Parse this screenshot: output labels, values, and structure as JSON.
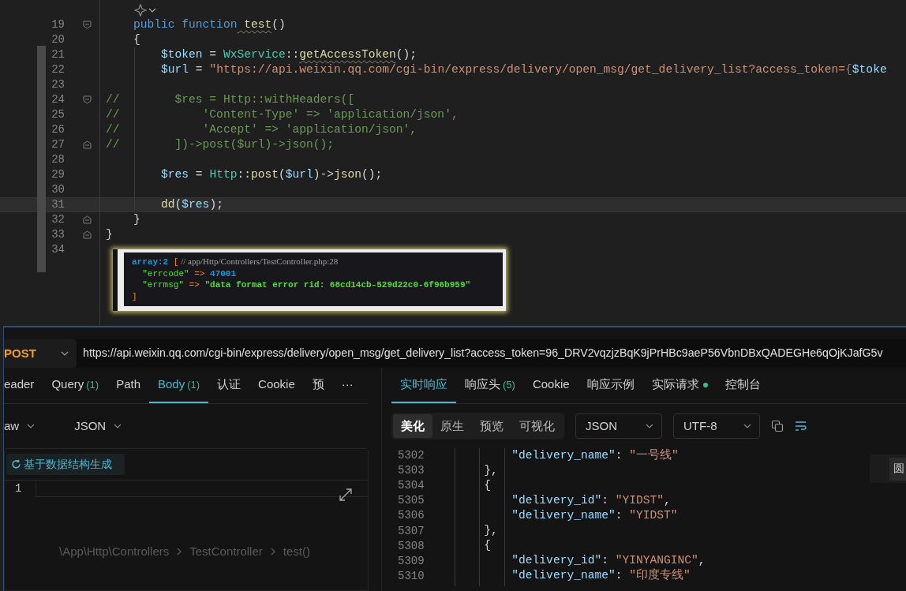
{
  "editor": {
    "lines": [
      {
        "number": "19",
        "kind": "fold-start",
        "current": false,
        "tokens": [
          {
            "text": "    public",
            "kind": "keyword"
          },
          {
            "text": " function",
            "kind": "keyword"
          },
          {
            "text": " test",
            "kind": "function",
            "warning": true
          },
          {
            "text": "()",
            "kind": "plain"
          }
        ]
      },
      {
        "number": "20",
        "kind": "plain",
        "current": false,
        "tokens": [
          {
            "text": "    {",
            "kind": "plain"
          }
        ]
      },
      {
        "number": "21",
        "kind": "plain",
        "current": false,
        "tokens": [
          {
            "text": "        $token",
            "kind": "variable"
          },
          {
            "text": " = ",
            "kind": "plain"
          },
          {
            "text": "WxService",
            "kind": "class"
          },
          {
            "text": "::",
            "kind": "plain"
          },
          {
            "text": "getAccessToken",
            "kind": "function",
            "warning": true
          },
          {
            "text": "();",
            "kind": "plain"
          }
        ]
      },
      {
        "number": "22",
        "kind": "plain",
        "current": false,
        "tokens": [
          {
            "text": "        $url",
            "kind": "variable"
          },
          {
            "text": " = ",
            "kind": "plain"
          },
          {
            "text": "\"https://api.weixin.qq.com/cgi-bin/express/delivery/open_msg/get_delivery_list?access_token=",
            "kind": "string"
          },
          {
            "text": "{",
            "kind": "brace"
          },
          {
            "text": "$toke",
            "kind": "variable"
          }
        ]
      },
      {
        "number": "23",
        "kind": "plain",
        "current": false
      },
      {
        "number": "24",
        "kind": "fold-start",
        "current": false,
        "tokens": [
          {
            "text": "//        $res = Http::withHeaders([",
            "kind": "comment"
          }
        ]
      },
      {
        "number": "25",
        "kind": "plain",
        "current": false,
        "tokens": [
          {
            "text": "//            'Content-Type' => 'application/json',",
            "kind": "comment"
          }
        ]
      },
      {
        "number": "26",
        "kind": "plain",
        "current": false,
        "tokens": [
          {
            "text": "//            'Accept' => 'application/json',",
            "kind": "comment"
          }
        ]
      },
      {
        "number": "27",
        "kind": "fold-end",
        "current": false,
        "tokens": [
          {
            "text": "//        ])->post($url)->json();",
            "kind": "comment"
          }
        ]
      },
      {
        "number": "28",
        "kind": "plain",
        "current": false
      },
      {
        "number": "29",
        "kind": "plain",
        "current": false,
        "tokens": [
          {
            "text": "        $res",
            "kind": "variable"
          },
          {
            "text": " = ",
            "kind": "plain"
          },
          {
            "text": "Http",
            "kind": "class"
          },
          {
            "text": "::",
            "kind": "plain"
          },
          {
            "text": "post",
            "kind": "function"
          },
          {
            "text": "(",
            "kind": "plain"
          },
          {
            "text": "$url",
            "kind": "variable"
          },
          {
            "text": ")->",
            "kind": "plain"
          },
          {
            "text": "json",
            "kind": "function"
          },
          {
            "text": "();",
            "kind": "plain"
          }
        ]
      },
      {
        "number": "30",
        "kind": "plain",
        "current": false
      },
      {
        "number": "31",
        "kind": "plain",
        "current": true,
        "tokens": [
          {
            "text": "        dd",
            "kind": "function"
          },
          {
            "text": "(",
            "kind": "plain"
          },
          {
            "text": "$res",
            "kind": "variable"
          },
          {
            "text": ");",
            "kind": "plain"
          }
        ]
      },
      {
        "number": "32",
        "kind": "fold-end",
        "current": false,
        "tokens": [
          {
            "text": "    }",
            "kind": "plain"
          }
        ]
      },
      {
        "number": "33",
        "kind": "fold-end",
        "current": false,
        "tokens": [
          {
            "text": "}",
            "kind": "plain"
          }
        ]
      },
      {
        "number": "34",
        "kind": "plain",
        "current": false
      }
    ]
  },
  "dump": {
    "lines": [
      [
        {
          "text": "array:2",
          "kind": "type"
        },
        {
          "text": " [",
          "kind": "punct"
        },
        {
          "text": " // app/Http/Controllers/TestController.php:28",
          "kind": "note"
        }
      ],
      [
        {
          "text": "  \"errcode\"",
          "kind": "key"
        },
        {
          "text": " =>",
          "kind": "punct"
        },
        {
          "text": " 47001",
          "kind": "number"
        }
      ],
      [
        {
          "text": "  \"errmsg\"",
          "kind": "key"
        },
        {
          "text": " =>",
          "kind": "punct"
        },
        {
          "text": " \"data format error rid: 68cd14cb-529d22c0-6f96b959\"",
          "kind": "string"
        }
      ],
      [
        {
          "text": "]",
          "kind": "punct"
        }
      ]
    ]
  },
  "apifox": {
    "method": "POST",
    "url": "https://api.weixin.qq.com/cgi-bin/express/delivery/open_msg/get_delivery_list?access_token=96_DRV2vqzjzBqK9jPrHBc9aeP56VbnDBxQADEGHe6qOjKJafG5v",
    "request_tabs": [
      {
        "label": "eader",
        "selected": false
      },
      {
        "label": "Query",
        "count": "(1)",
        "selected": false
      },
      {
        "label": "Path",
        "selected": false
      },
      {
        "label": "Body",
        "count": "(1)",
        "selected": true
      },
      {
        "label": "认证",
        "selected": false
      },
      {
        "label": "Cookie",
        "selected": false
      },
      {
        "label": "预",
        "selected": false
      }
    ],
    "more": "···",
    "body_mode": "aw",
    "body_format": "JSON",
    "generate_button": "基于数据结构生成",
    "body_lines": [
      "1"
    ],
    "breadcrumb": [
      "\\App\\Http\\Controllers",
      "TestController",
      "test()"
    ],
    "response_tabs": [
      {
        "label": "实时响应",
        "selected": true
      },
      {
        "label": "响应头",
        "count": "(5)",
        "selected": false
      },
      {
        "label": "Cookie",
        "selected": false
      },
      {
        "label": "响应示例",
        "selected": false
      },
      {
        "label": "实际请求",
        "selected": false,
        "color": "#2bc48a"
      },
      {
        "label": "控制台",
        "selected": false
      }
    ],
    "view_modes": [
      {
        "label": "美化",
        "selected": true
      },
      {
        "label": "原生",
        "selected": false
      },
      {
        "label": "预览",
        "selected": false
      },
      {
        "label": "可视化",
        "selected": false
      }
    ],
    "format": "JSON",
    "encoding": "UTF-8",
    "response_lines": [
      {
        "number": "5302",
        "tokens": [
          {
            "text": "           \"delivery_name\"",
            "kind": "key"
          },
          {
            "text": ": ",
            "kind": "punct"
          },
          {
            "text": "\"一号线\"",
            "kind": "string"
          }
        ]
      },
      {
        "number": "5303",
        "tokens": [
          {
            "text": "       },",
            "kind": "punct"
          }
        ]
      },
      {
        "number": "5304",
        "tokens": [
          {
            "text": "       {",
            "kind": "punct"
          }
        ]
      },
      {
        "number": "5305",
        "tokens": [
          {
            "text": "           \"delivery_id\"",
            "kind": "key"
          },
          {
            "text": ": ",
            "kind": "punct"
          },
          {
            "text": "\"YIDST\"",
            "kind": "string"
          },
          {
            "text": ",",
            "kind": "punct"
          }
        ]
      },
      {
        "number": "5306",
        "tokens": [
          {
            "text": "           \"delivery_name\"",
            "kind": "key"
          },
          {
            "text": ": ",
            "kind": "punct"
          },
          {
            "text": "\"YIDST\"",
            "kind": "string"
          }
        ]
      },
      {
        "number": "5307",
        "tokens": [
          {
            "text": "       },",
            "kind": "punct"
          }
        ]
      },
      {
        "number": "5308",
        "tokens": [
          {
            "text": "       {",
            "kind": "punct"
          }
        ]
      },
      {
        "number": "5309",
        "tokens": [
          {
            "text": "           \"delivery_id\"",
            "kind": "key"
          },
          {
            "text": ": ",
            "kind": "punct"
          },
          {
            "text": "\"YINYANGINC\"",
            "kind": "string"
          },
          {
            "text": ",",
            "kind": "punct"
          }
        ]
      },
      {
        "number": "5310",
        "tokens": [
          {
            "text": "           \"delivery_name\"",
            "kind": "key"
          },
          {
            "text": ": ",
            "kind": "punct"
          },
          {
            "text": "\"印度专线\"",
            "kind": "string"
          }
        ]
      }
    ],
    "side_tab": "圆"
  }
}
